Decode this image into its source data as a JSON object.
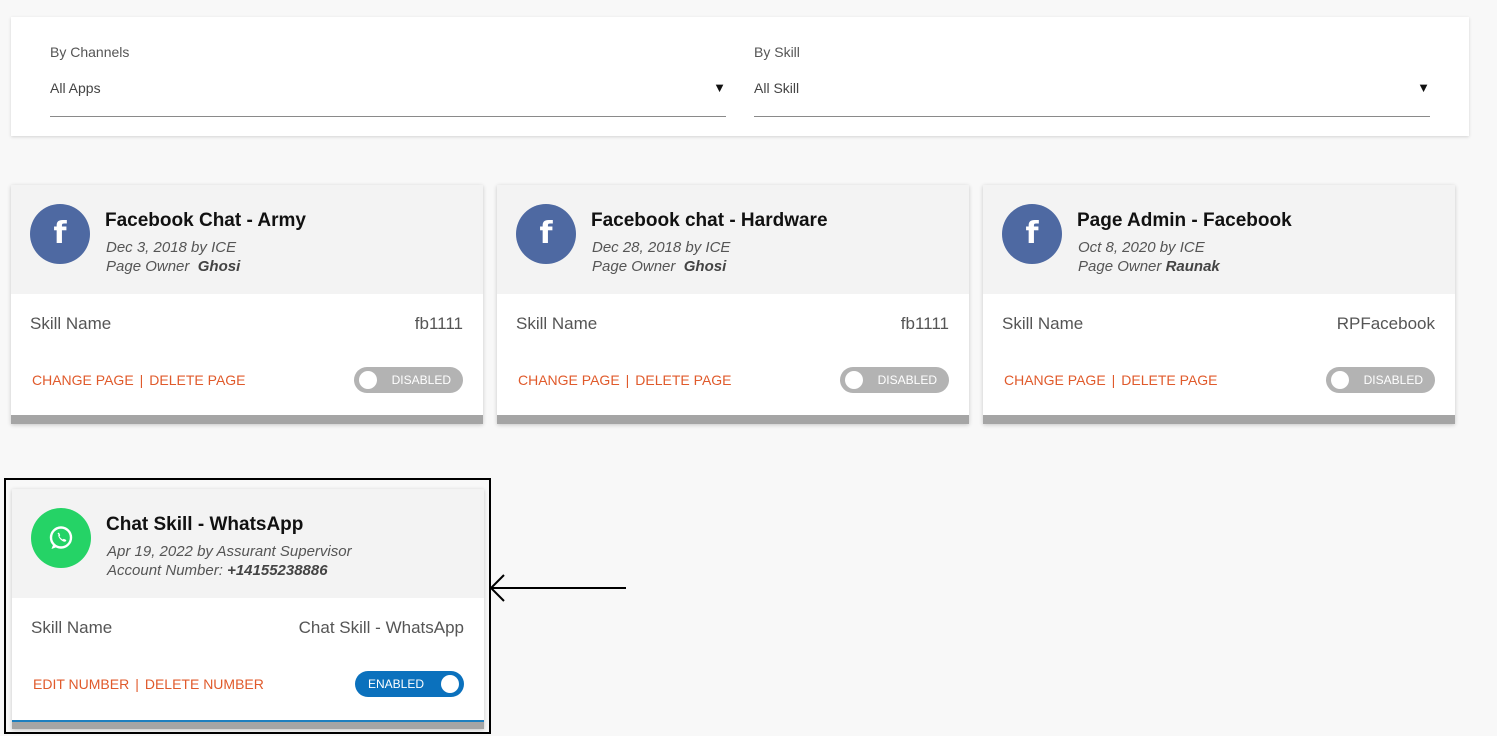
{
  "filters": {
    "channels": {
      "label": "By Channels",
      "value": "All Apps"
    },
    "skill": {
      "label": "By Skill",
      "value": "All Skill"
    }
  },
  "cards": [
    {
      "channel_icon": "facebook-icon",
      "title": "Facebook Chat - Army",
      "date_line": "Dec 3, 2018 by ICE",
      "owner_label": "Page Owner",
      "owner_value": "Ghosi",
      "skill_label": "Skill Name",
      "skill_value": "fb1111",
      "action1": "CHANGE PAGE",
      "action2": "DELETE PAGE",
      "status": "DISABLED"
    },
    {
      "channel_icon": "facebook-icon",
      "title": "Facebook chat - Hardware",
      "date_line": "Dec 28, 2018 by ICE",
      "owner_label": "Page Owner",
      "owner_value": "Ghosi",
      "skill_label": "Skill Name",
      "skill_value": "fb1111",
      "action1": "CHANGE PAGE",
      "action2": "DELETE PAGE",
      "status": "DISABLED"
    },
    {
      "channel_icon": "facebook-icon",
      "title": "Page Admin - Facebook",
      "date_line": "Oct 8, 2020 by ICE",
      "owner_label": "Page Owner",
      "owner_value": "Raunak",
      "skill_label": "Skill Name",
      "skill_value": "RPFacebook",
      "action1": "CHANGE PAGE",
      "action2": "DELETE PAGE",
      "status": "DISABLED"
    },
    {
      "channel_icon": "whatsapp-icon",
      "title": "Chat Skill - WhatsApp",
      "date_line": "Apr 19, 2022 by Assurant Supervisor",
      "owner_label": "Account Number:",
      "owner_value": "+14155238886",
      "skill_label": "Skill Name",
      "skill_value": "Chat Skill - WhatsApp",
      "action1": "EDIT NUMBER",
      "action2": "DELETE NUMBER",
      "status": "ENABLED"
    }
  ],
  "colors": {
    "facebook": "#4e69a2",
    "whatsapp": "#25d366",
    "link": "#e05a2b",
    "toggle_on": "#0b71bd",
    "toggle_off": "#b3b3b3"
  }
}
